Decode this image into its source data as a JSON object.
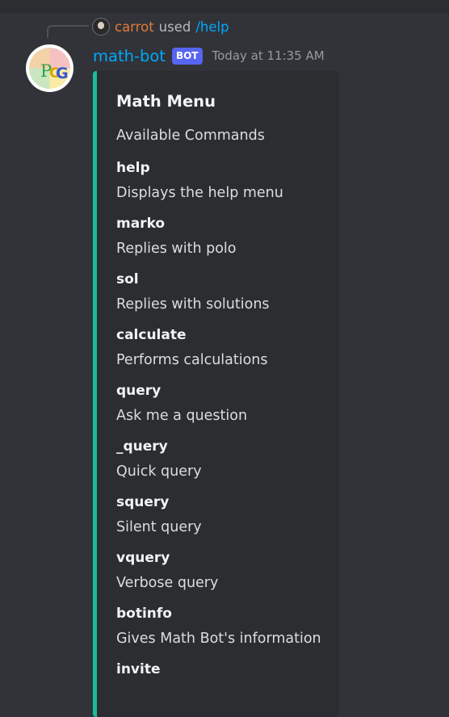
{
  "reply": {
    "username": "carrot",
    "used_text": "used",
    "command": "/help"
  },
  "message": {
    "author": "math-bot",
    "badge": "BOT",
    "timestamp": "Today at 11:35 AM",
    "avatar_letters": [
      "P",
      "C",
      "G"
    ]
  },
  "embed": {
    "accent_color": "#1abc9c",
    "title": "Math Menu",
    "description": "Available Commands",
    "fields": [
      {
        "name": "help",
        "value": "Displays the help menu"
      },
      {
        "name": "marko",
        "value": "Replies with polo"
      },
      {
        "name": "sol",
        "value": "Replies with solutions"
      },
      {
        "name": "calculate",
        "value": "Performs calculations"
      },
      {
        "name": "query",
        "value": "Ask me a question"
      },
      {
        "name": "_query",
        "value": "Quick query"
      },
      {
        "name": "squery",
        "value": "Silent query"
      },
      {
        "name": "vquery",
        "value": "Verbose query"
      },
      {
        "name": "botinfo",
        "value": "Gives Math Bot's information"
      },
      {
        "name": "invite",
        "value": ""
      }
    ]
  },
  "colors": {
    "background": "#313338",
    "link": "#00a8fc",
    "reply_user": "#e07b39",
    "badge": "#5865f2"
  }
}
